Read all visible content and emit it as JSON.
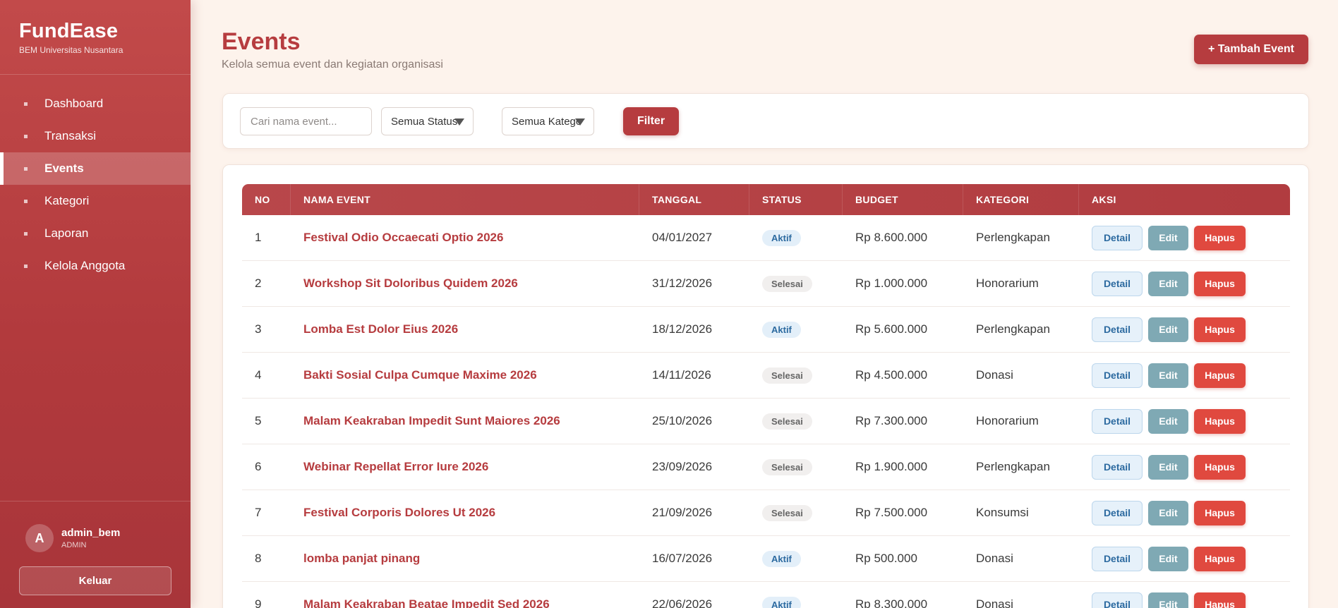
{
  "sidebar": {
    "brand": "FundEase",
    "sub": "BEM Universitas Nusantara",
    "items": [
      {
        "label": "Dashboard",
        "active": false
      },
      {
        "label": "Transaksi",
        "active": false
      },
      {
        "label": "Events",
        "active": true
      },
      {
        "label": "Kategori",
        "active": false
      },
      {
        "label": "Laporan",
        "active": false
      },
      {
        "label": "Kelola Anggota",
        "active": false
      }
    ],
    "user": {
      "initial": "A",
      "name": "admin_bem",
      "role": "ADMIN"
    },
    "logout_label": "Keluar"
  },
  "header": {
    "title": "Events",
    "subtitle": "Kelola semua event dan kegiatan organisasi",
    "add_label": "+ Tambah Event"
  },
  "filters": {
    "search_placeholder": "Cari nama event...",
    "status_selected": "Semua Status",
    "category_selected": "Semua Kategori",
    "filter_label": "Filter"
  },
  "table": {
    "columns": [
      "NO",
      "NAMA EVENT",
      "TANGGAL",
      "STATUS",
      "BUDGET",
      "KATEGORI",
      "AKSI"
    ],
    "actions": {
      "detail": "Detail",
      "edit": "Edit",
      "hapus": "Hapus"
    },
    "rows": [
      {
        "no": "1",
        "name": "Festival Odio Occaecati Optio 2026",
        "date": "04/01/2027",
        "status": "Aktif",
        "budget": "Rp 8.600.000",
        "category": "Perlengkapan"
      },
      {
        "no": "2",
        "name": "Workshop Sit Doloribus Quidem 2026",
        "date": "31/12/2026",
        "status": "Selesai",
        "budget": "Rp 1.000.000",
        "category": "Honorarium"
      },
      {
        "no": "3",
        "name": "Lomba Est Dolor Eius 2026",
        "date": "18/12/2026",
        "status": "Aktif",
        "budget": "Rp 5.600.000",
        "category": "Perlengkapan"
      },
      {
        "no": "4",
        "name": "Bakti Sosial Culpa Cumque Maxime 2026",
        "date": "14/11/2026",
        "status": "Selesai",
        "budget": "Rp 4.500.000",
        "category": "Donasi"
      },
      {
        "no": "5",
        "name": "Malam Keakraban Impedit Sunt Maiores 2026",
        "date": "25/10/2026",
        "status": "Selesai",
        "budget": "Rp 7.300.000",
        "category": "Honorarium"
      },
      {
        "no": "6",
        "name": "Webinar Repellat Error Iure 2026",
        "date": "23/09/2026",
        "status": "Selesai",
        "budget": "Rp 1.900.000",
        "category": "Perlengkapan"
      },
      {
        "no": "7",
        "name": "Festival Corporis Dolores Ut 2026",
        "date": "21/09/2026",
        "status": "Selesai",
        "budget": "Rp 7.500.000",
        "category": "Konsumsi"
      },
      {
        "no": "8",
        "name": "lomba panjat pinang",
        "date": "16/07/2026",
        "status": "Aktif",
        "budget": "Rp 500.000",
        "category": "Donasi"
      },
      {
        "no": "9",
        "name": "Malam Keakraban Beatae Impedit Sed 2026",
        "date": "22/06/2026",
        "status": "Aktif",
        "budget": "Rp 8.300.000",
        "category": "Donasi"
      }
    ]
  }
}
